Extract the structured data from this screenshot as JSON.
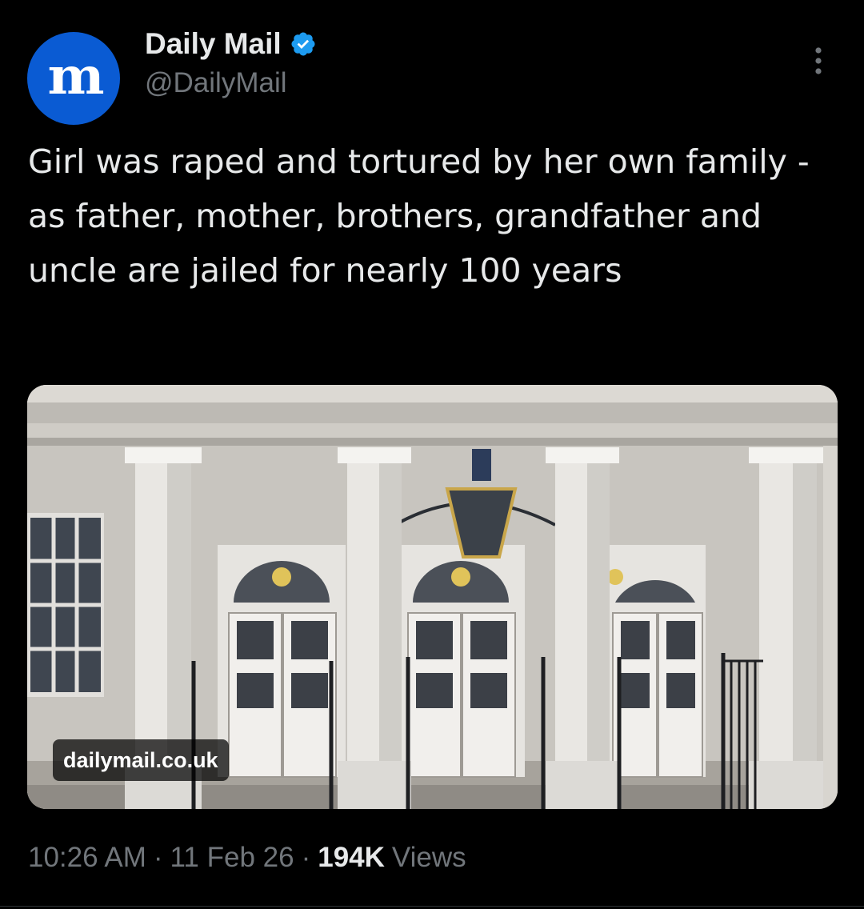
{
  "account": {
    "avatar_letter": "m",
    "display_name": "Daily Mail",
    "handle": "@DailyMail",
    "verified": true,
    "brand_color": "#0a5bd3",
    "verified_color": "#1d9bf0"
  },
  "menu_icon": "more-vertical-icon",
  "tweet": {
    "text": "Girl was raped and tortured by her own family - as father, mother, brothers, grandfather and uncle are jailed for nearly 100 years"
  },
  "media": {
    "source": "dailymail.co.uk"
  },
  "meta": {
    "time": "10:26 AM",
    "date": "11 Feb 26",
    "separator": "·",
    "views_count": "194K",
    "views_label": "Views"
  }
}
